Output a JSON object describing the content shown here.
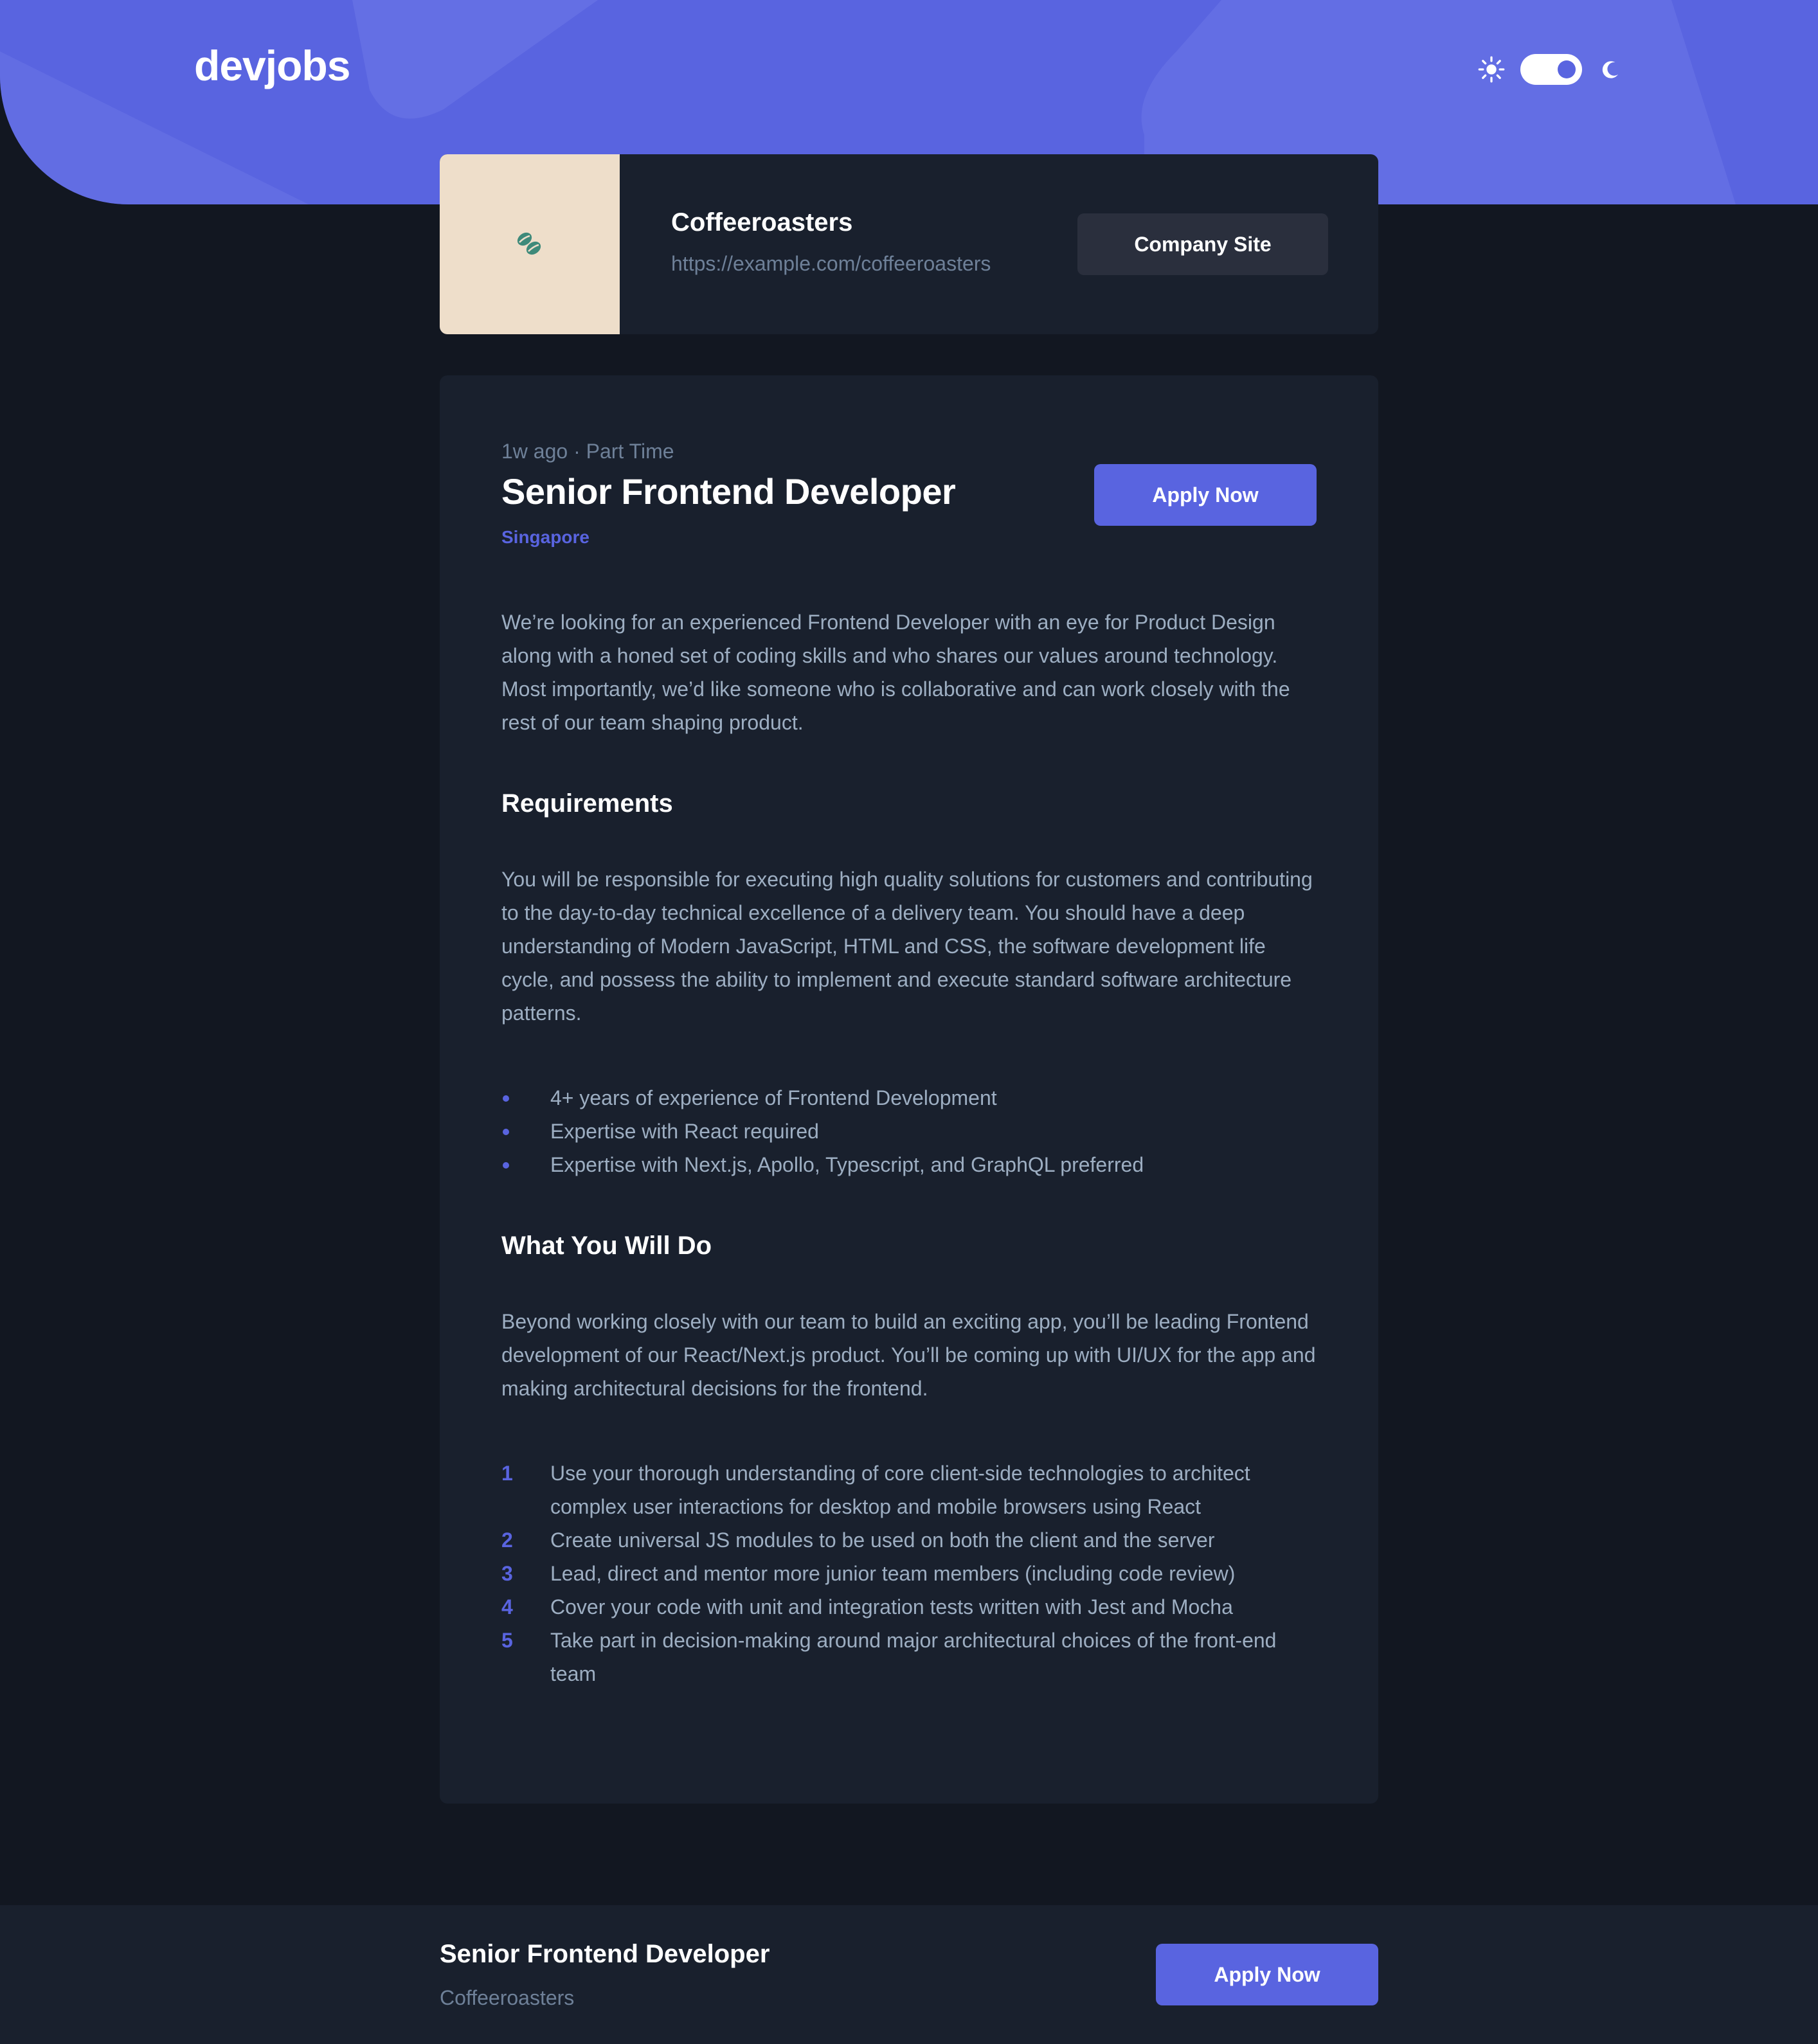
{
  "header": {
    "logo": "devjobs",
    "theme": {
      "sun_icon": "sun-icon",
      "moon_icon": "moon-icon",
      "dark_mode": true
    }
  },
  "company": {
    "name": "Coffeeroasters",
    "url": "https://example.com/coffeeroasters",
    "logo_icon": "coffee-beans-icon",
    "site_button": "Company Site"
  },
  "job": {
    "posted": "1w ago",
    "separator": "·",
    "contract": "Part Time",
    "title": "Senior Frontend Developer",
    "location": "Singapore",
    "apply_label": "Apply Now",
    "description": "We’re looking for an experienced Frontend Developer with an eye for Product Design along with a honed set of coding skills and who shares our values around technology. Most importantly, we’d like someone who is collaborative and can work closely with the rest of our team shaping product.",
    "requirements": {
      "heading": "Requirements",
      "content": "You will be responsible for executing high quality solutions for customers and contributing to the day-to-day technical excellence of a delivery team. You should have a deep understanding of Modern JavaScript, HTML and CSS, the software development life cycle, and possess the ability to implement and execute standard software architecture patterns.",
      "items": [
        "4+ years of experience of Frontend Development",
        "Expertise with React required",
        "Expertise with Next.js, Apollo, Typescript, and GraphQL preferred"
      ]
    },
    "role": {
      "heading": "What You Will Do",
      "content": "Beyond working closely with our team to build an exciting app, you’ll be leading Frontend development of our React/Next.js product. You’ll be coming up with UI/UX for the app and making architectural decisions for the frontend.",
      "items": [
        {
          "num": "1",
          "text": "Use your thorough understanding of core client-side technologies to architect complex user interactions for desktop and mobile browsers using React"
        },
        {
          "num": "2",
          "text": "Create universal JS modules to be used on both the client and the server"
        },
        {
          "num": "3",
          "text": "Lead, direct and mentor more junior team members (including code review)"
        },
        {
          "num": "4",
          "text": "Cover your code with unit and integration tests written with Jest and Mocha"
        },
        {
          "num": "5",
          "text": "Take part in decision-making around major architectural choices of the front-end team"
        }
      ]
    }
  },
  "footer": {
    "title": "Senior Frontend Developer",
    "company": "Coffeeroasters",
    "apply_label": "Apply Now"
  },
  "colors": {
    "accent": "#5964E0",
    "background": "#121721",
    "card": "#19202D",
    "text_muted": "#9DAEC2",
    "text_dim": "#6E8098",
    "logo_bg": "#EEDECA",
    "logo_mark": "#3E8A7A"
  }
}
